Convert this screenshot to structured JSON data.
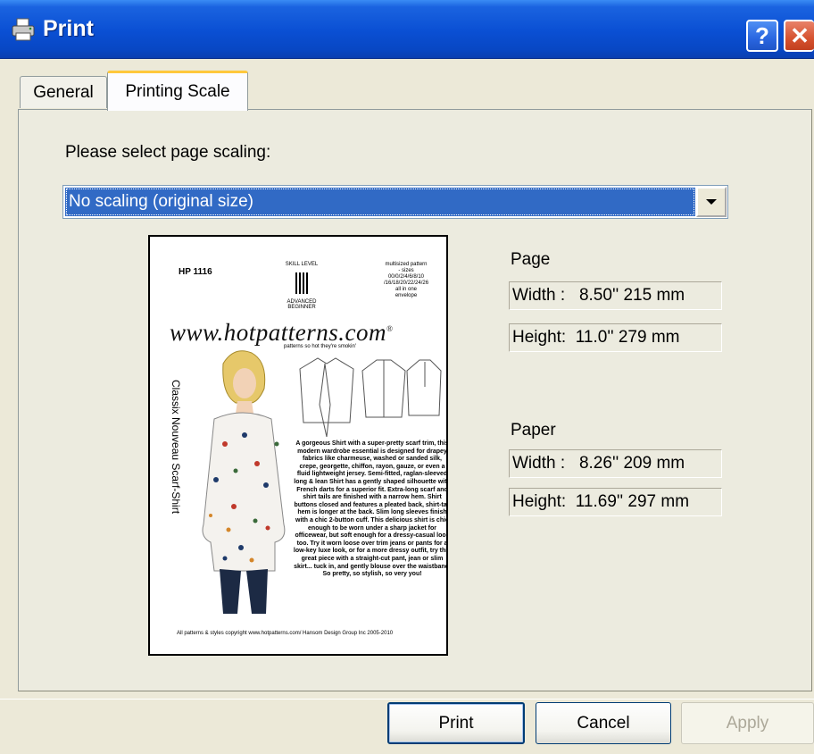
{
  "window": {
    "title": "Print",
    "help_label": "?",
    "close_label": "✕"
  },
  "tabs": [
    {
      "label": "General"
    },
    {
      "label": "Printing Scale"
    }
  ],
  "scaling": {
    "prompt": "Please select page scaling:",
    "selected": "No scaling (original size)"
  },
  "preview": {
    "code": "HP 1116",
    "skill_heading": "SKILL LEVEL",
    "skill_level": "ADVANCED BEGINNER",
    "sizes": "multisized pattern - sizes 00/0/2/4/6/8/10 /16/18/20/22/24/26 all in one envelope",
    "url": "www.hotpatterns.com",
    "url_mark": "®",
    "tagline": "patterns so hot they're smokin'",
    "title": "Classix Nouveau Scarf-Shirt",
    "description": "A gorgeous Shirt with a super-pretty scarf trim, this modern wardrobe essential is designed for drapey fabrics like charmeuse, washed or sanded silk, crepe, georgette, chiffon, rayon, gauze, or even a fluid lightweight jersey. Semi-fitted, raglan-sleeved long & lean Shirt has a gently shaped silhouette with French darts for a superior fit. Extra-long scarf and shirt tails are finished with a narrow hem. Shirt buttons closed and features a pleated back, shirt-tail hem is longer at the back. Slim long sleeves finish with a chic 2-button cuff. This delicious shirt is chic enough to be worn under a sharp jacket for officewear, but soft enough for a dressy-casual look too. Try it worn loose over trim jeans or pants for a low-key luxe look, or for a more dressy outfit, try this great piece with a straight-cut pant, jean or slim skirt... tuck in, and gently blouse over the waistband. So pretty, so stylish, so very you!",
    "footer": "All patterns & styles copyright www.hotpatterns.com/ Hansom Design Group Inc 2005-2010"
  },
  "page_info": {
    "label": "Page",
    "width": "Width :   8.50'' 215 mm",
    "height": "Height:  11.0'' 279 mm"
  },
  "paper_info": {
    "label": "Paper",
    "width": "Width :   8.26'' 209 mm",
    "height": "Height:  11.69'' 297 mm"
  },
  "buttons": {
    "print": "Print",
    "cancel": "Cancel",
    "apply": "Apply"
  },
  "colors": {
    "titlebar": "#0a4fd3",
    "selection": "#316ac5",
    "dialog_bg": "#ece9d8"
  }
}
